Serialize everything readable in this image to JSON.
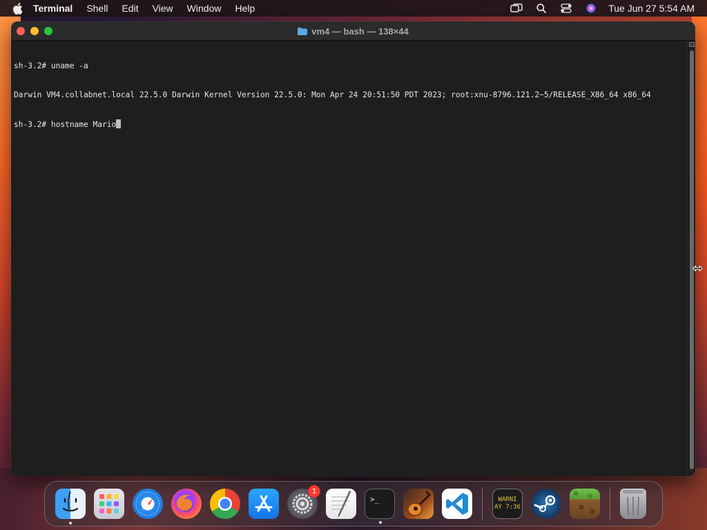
{
  "menubar": {
    "app_name": "Terminal",
    "items": [
      "Shell",
      "Edit",
      "View",
      "Window",
      "Help"
    ],
    "clock": "Tue Jun 27  5:54 AM"
  },
  "window": {
    "title": "vm4 — bash — 138×44",
    "lines": [
      "sh-3.2# uname -a",
      "Darwin VM4.collabnet.local 22.5.0 Darwin Kernel Version 22.5.0: Mon Apr 24 20:51:50 PDT 2023; root:xnu-8796.121.2~5/RELEASE_X86_64 x86_64",
      "sh-3.2# hostname Mario"
    ]
  },
  "dock": {
    "apps": [
      {
        "name": "Finder",
        "icon": "finder-icon",
        "running": true
      },
      {
        "name": "Launchpad",
        "icon": "launchpad-icon"
      },
      {
        "name": "Safari",
        "icon": "safari-icon"
      },
      {
        "name": "Firefox",
        "icon": "firefox-icon"
      },
      {
        "name": "Chrome",
        "icon": "chrome-icon"
      },
      {
        "name": "App Store",
        "icon": "appstore-icon"
      },
      {
        "name": "System Settings",
        "icon": "settings-icon",
        "badge": "1"
      },
      {
        "name": "TextEdit",
        "icon": "textedit-icon"
      },
      {
        "name": "Terminal",
        "icon": "terminal-icon",
        "running": true
      },
      {
        "name": "GarageBand",
        "icon": "garageband-icon"
      },
      {
        "name": "Visual Studio Code",
        "icon": "vscode-icon"
      },
      {
        "name": "Console",
        "icon": "console-icon",
        "text": "WARNI\nAY 7:36"
      },
      {
        "name": "Steam",
        "icon": "steam-icon"
      },
      {
        "name": "Minecraft",
        "icon": "minecraft-icon"
      },
      {
        "name": "Trash",
        "icon": "trash-icon"
      }
    ]
  }
}
